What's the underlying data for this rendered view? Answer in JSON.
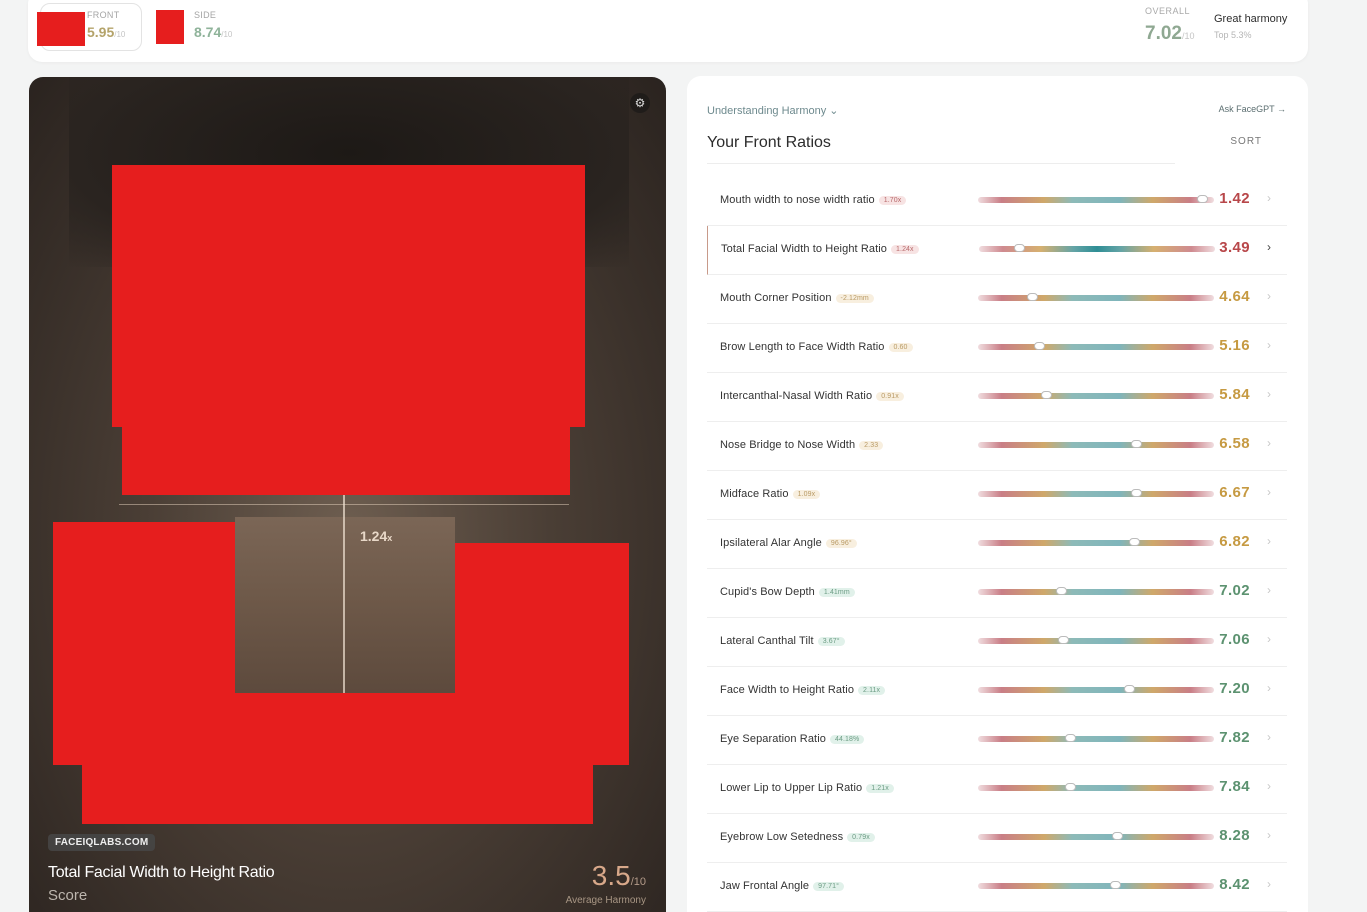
{
  "header": {
    "front": {
      "label": "FRONT",
      "score": "5.95",
      "unit": "/10"
    },
    "side": {
      "label": "SIDE",
      "score": "8.74",
      "unit": "/10"
    },
    "overall": {
      "label": "OVERALL",
      "score": "7.02",
      "unit": "/10",
      "harmony": "Great harmony",
      "rank": "Top 5.3%"
    }
  },
  "photo": {
    "measurement": "1.24",
    "measurement_unit": "x",
    "source": "FACEIQLABS.COM",
    "title": "Total Facial Width to Height Ratio",
    "subtitle": "Score",
    "score": "3.5",
    "score_unit": "/10",
    "score_caption": "Average Harmony",
    "gear_icon": "⚙"
  },
  "panel": {
    "understanding": "Understanding Harmony",
    "understanding_chevron": "⌄",
    "ask": "Ask FaceGPT →",
    "title": "Your Front Ratios",
    "sort": "SORT",
    "row_chevron": "›"
  },
  "ratios": [
    {
      "name": "Mouth width to nose width ratio",
      "pill": "1.70x",
      "score": "1.42",
      "position": 0.95,
      "tone": "bad",
      "active": false
    },
    {
      "name": "Total Facial Width to Height Ratio",
      "pill": "1.24x",
      "score": "3.49",
      "position": 0.17,
      "tone": "bad",
      "active": true
    },
    {
      "name": "Mouth Corner Position",
      "pill": "-2.12mm",
      "score": "4.64",
      "position": 0.23,
      "tone": "mid",
      "active": false
    },
    {
      "name": "Brow Length to Face Width Ratio",
      "pill": "0.60",
      "score": "5.16",
      "position": 0.26,
      "tone": "mid",
      "active": false
    },
    {
      "name": "Intercanthal-Nasal Width Ratio",
      "pill": "0.91x",
      "score": "5.84",
      "position": 0.29,
      "tone": "mid",
      "active": false
    },
    {
      "name": "Nose Bridge to Nose Width",
      "pill": "2.33",
      "score": "6.58",
      "position": 0.67,
      "tone": "mid",
      "active": false
    },
    {
      "name": "Midface Ratio",
      "pill": "1.09x",
      "score": "6.67",
      "position": 0.67,
      "tone": "mid",
      "active": false
    },
    {
      "name": "Ipsilateral Alar Angle",
      "pill": "96.96°",
      "score": "6.82",
      "position": 0.66,
      "tone": "mid",
      "active": false
    },
    {
      "name": "Cupid's Bow Depth",
      "pill": "1.41mm",
      "score": "7.02",
      "position": 0.35,
      "tone": "good",
      "active": false
    },
    {
      "name": "Lateral Canthal Tilt",
      "pill": "3.67°",
      "score": "7.06",
      "position": 0.36,
      "tone": "good",
      "active": false
    },
    {
      "name": "Face Width to Height Ratio",
      "pill": "2.11x",
      "score": "7.20",
      "position": 0.64,
      "tone": "good",
      "active": false
    },
    {
      "name": "Eye Separation Ratio",
      "pill": "44.18%",
      "score": "7.82",
      "position": 0.39,
      "tone": "good",
      "active": false
    },
    {
      "name": "Lower Lip to Upper Lip Ratio",
      "pill": "1.21x",
      "score": "7.84",
      "position": 0.39,
      "tone": "good",
      "active": false
    },
    {
      "name": "Eyebrow Low Setedness",
      "pill": "0.79x",
      "score": "8.28",
      "position": 0.59,
      "tone": "good",
      "active": false
    },
    {
      "name": "Jaw Frontal Angle",
      "pill": "97.71°",
      "score": "8.42",
      "position": 0.58,
      "tone": "good",
      "active": false
    }
  ],
  "colors": {
    "bad": "#b8474a",
    "mid": "#c69a42",
    "good": "#5c9270",
    "redaction": "#e61e1e"
  }
}
